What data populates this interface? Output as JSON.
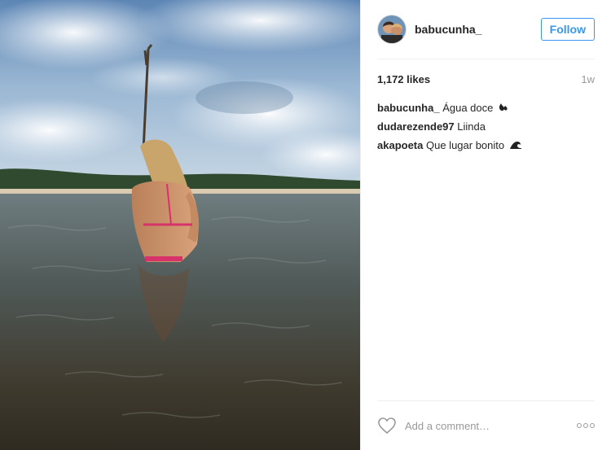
{
  "post": {
    "username": "babucunha_",
    "follow_label": "Follow",
    "likes": "1,172 likes",
    "time_ago": "1w",
    "comments": [
      {
        "user": "babucunha_",
        "text": "Água doce",
        "emoji": "water-drop-emoji"
      },
      {
        "user": "dudarezende97",
        "text": "Liinda",
        "emoji": ""
      },
      {
        "user": "akapoeta",
        "text": "Que lugar bonito",
        "emoji": "wave-emoji"
      }
    ],
    "comment_placeholder": "Add a comment…"
  },
  "colors": {
    "accent": "#3897f0",
    "text": "#262626",
    "muted": "#999999",
    "divider": "#efefef"
  }
}
